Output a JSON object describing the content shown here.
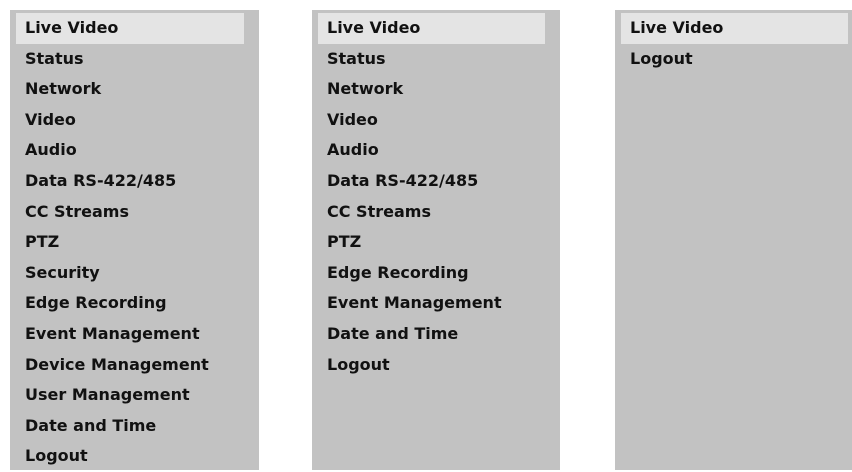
{
  "panels": [
    {
      "items": [
        "Live Video",
        "Status",
        "Network",
        "Video",
        "Audio",
        "Data RS-422/485",
        "CC Streams",
        "PTZ",
        "Security",
        "Edge Recording",
        "Event Management",
        "Device Management",
        "User Management",
        "Date and Time",
        "Logout"
      ],
      "active": "Live Video"
    },
    {
      "items": [
        "Live Video",
        "Status",
        "Network",
        "Video",
        "Audio",
        "Data RS-422/485",
        "CC Streams",
        "PTZ",
        "Edge Recording",
        "Event Management",
        "Date and Time",
        "Logout"
      ],
      "active": "Live Video"
    },
    {
      "items": [
        "Live Video",
        "Logout"
      ],
      "active": "Live Video"
    }
  ],
  "colors": {
    "panel_bg": "#c2c2c2",
    "active_bg": "#e4e4e4",
    "text": "#111111"
  }
}
